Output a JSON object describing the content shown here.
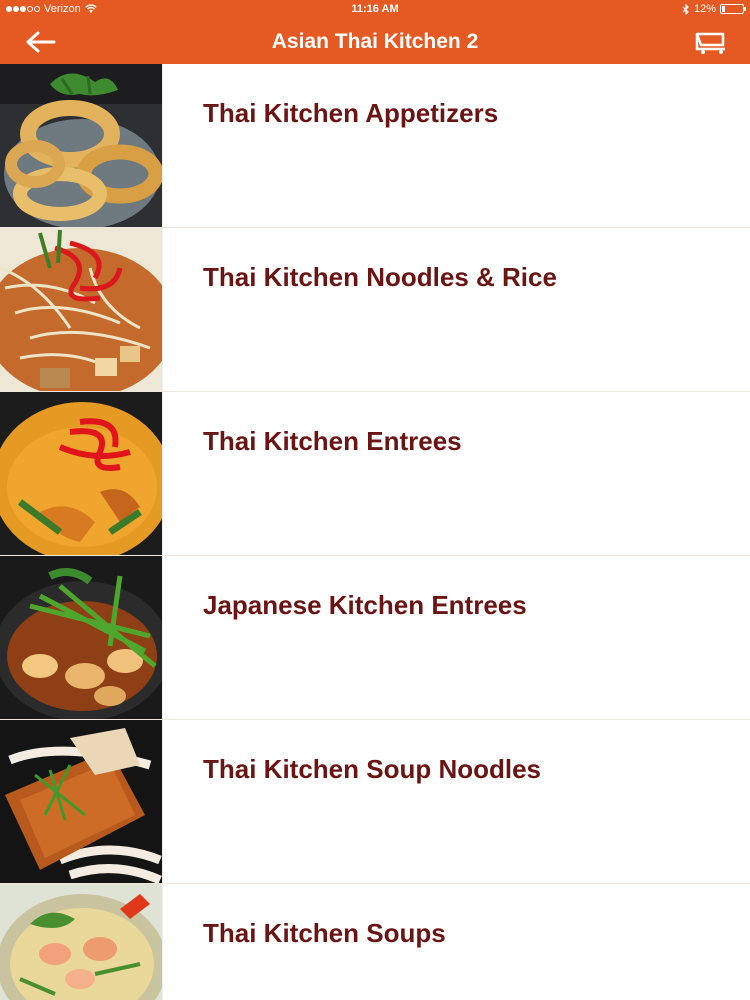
{
  "status_bar": {
    "carrier": "Verizon",
    "time": "11:16 AM",
    "battery": "12%",
    "battery_level": 0.12
  },
  "nav": {
    "title": "Asian Thai Kitchen 2",
    "back_icon": "back-arrow-icon",
    "cart_icon": "cart-icon"
  },
  "menu": {
    "items": [
      {
        "label": "Thai Kitchen Appetizers"
      },
      {
        "label": "Thai Kitchen Noodles & Rice"
      },
      {
        "label": "Thai Kitchen Entrees"
      },
      {
        "label": "Japanese Kitchen Entrees"
      },
      {
        "label": "Thai Kitchen Soup Noodles"
      },
      {
        "label": "Thai Kitchen Soups"
      }
    ]
  },
  "colors": {
    "brand": "#e55a22",
    "label": "#6b1414"
  }
}
